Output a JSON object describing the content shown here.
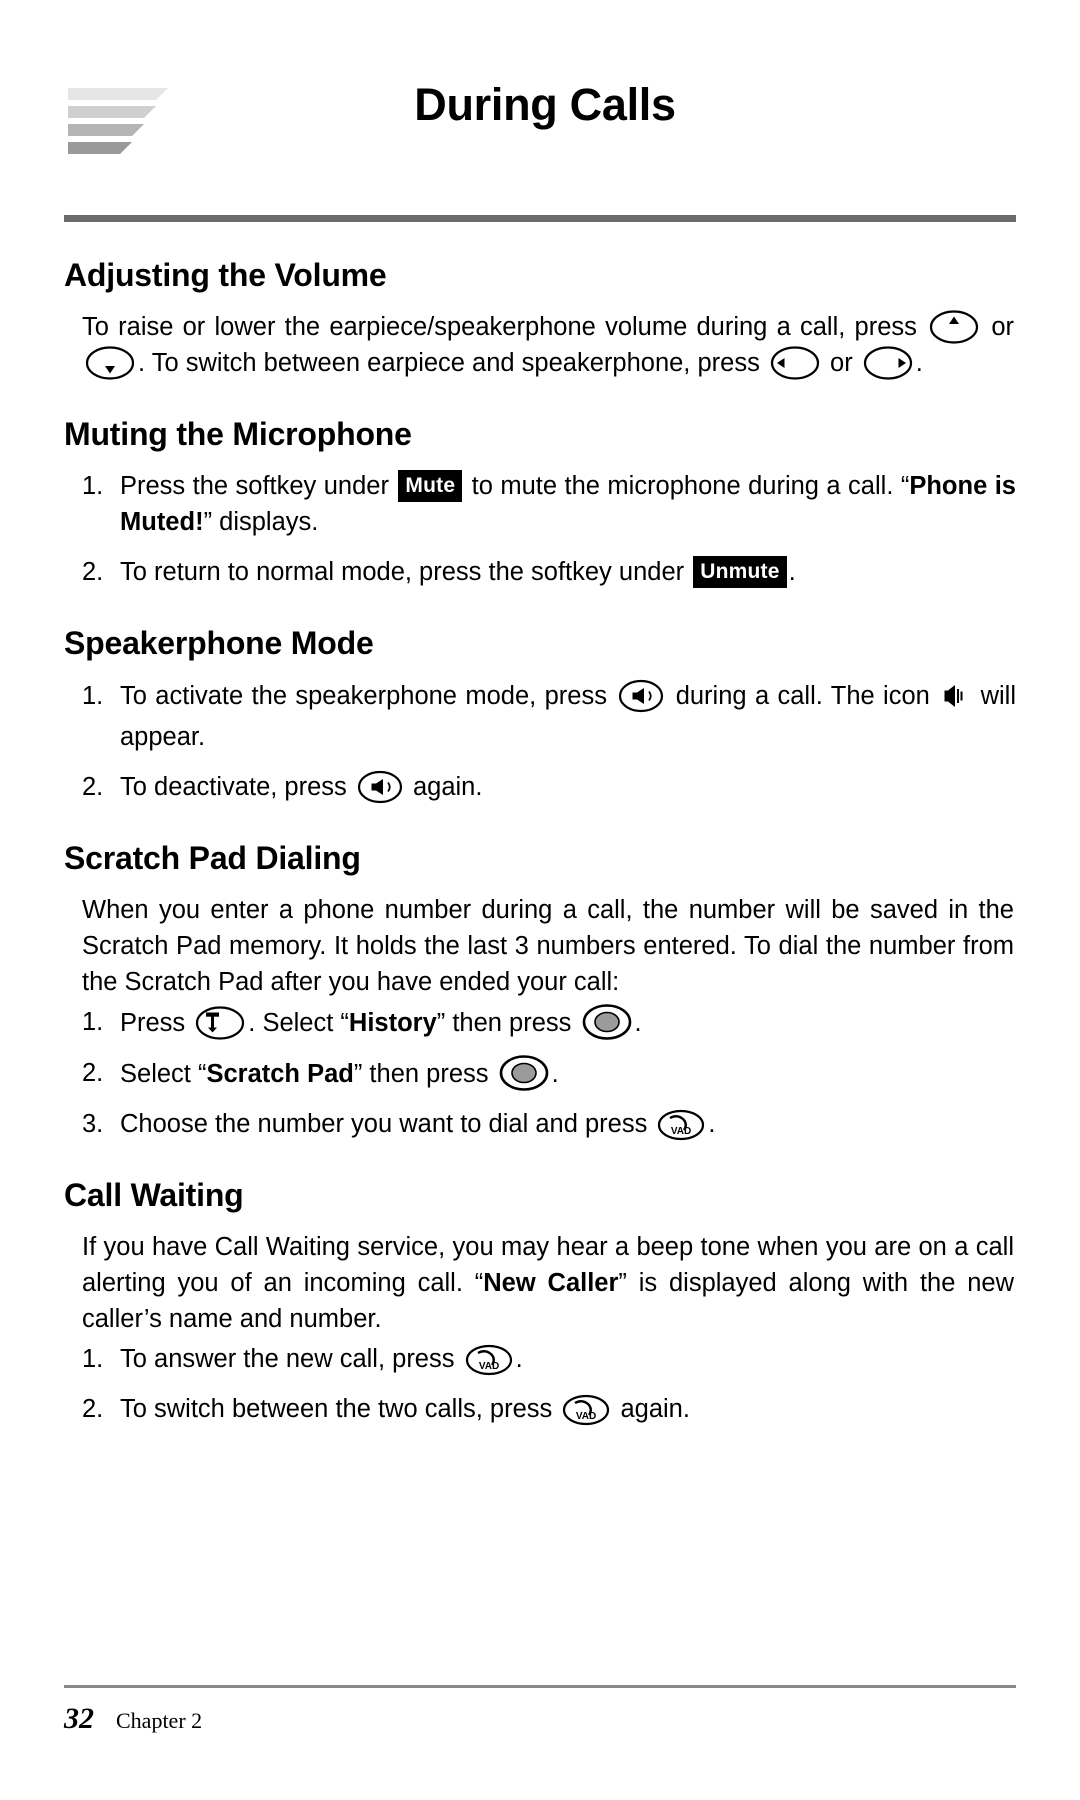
{
  "header": {
    "title": "During Calls",
    "logo_icon": "chevron-stack-logo"
  },
  "sections": [
    {
      "id": "adjusting-the-volume",
      "title": "Adjusting the Volume",
      "paragraph_part1": "To raise or lower the earpiece/speakerphone volume during a call, press ",
      "paragraph_part2": " or ",
      "paragraph_part3": ". To switch between earpiece and speakerphone, press ",
      "paragraph_part4": " or ",
      "paragraph_part5": ".",
      "icons": [
        "nav-up-key-icon",
        "nav-down-key-icon",
        "nav-left-key-icon",
        "nav-right-key-icon"
      ]
    },
    {
      "id": "muting-the-microphone",
      "title": "Muting the Microphone",
      "steps": [
        {
          "num": "1.",
          "part1": "Press the softkey under ",
          "badge": "Mute",
          "part2": " to mute the microphone during a call.  “",
          "bold": "Phone is Muted!",
          "part3": "” displays."
        },
        {
          "num": "2.",
          "part1": "To return to normal mode, press the softkey under ",
          "badge": "Unmute",
          "part2": "."
        }
      ]
    },
    {
      "id": "speakerphone-mode",
      "title": "Speakerphone Mode",
      "steps": [
        {
          "num": "1.",
          "part1": "To activate the speakerphone mode, press ",
          "part2": " during a call. The icon ",
          "part3": " will appear.",
          "icons": [
            "speakerphone-key-icon",
            "speaker-indicator-icon"
          ]
        },
        {
          "num": "2.",
          "part1": "To deactivate, press ",
          "part2": " again.",
          "icons": [
            "speakerphone-key-icon"
          ]
        }
      ]
    },
    {
      "id": "scratch-pad-dialing",
      "title": "Scratch Pad Dialing",
      "paragraph": "When you enter a phone number during a call, the number will be saved in the Scratch Pad memory. It holds the last 3 numbers entered. To dial the number from the Scratch Pad after you have ended your call:",
      "steps": [
        {
          "num": "1.",
          "part1": "Press ",
          "part2": ". Select “",
          "bold": "History",
          "part3": "” then press ",
          "part4": ".",
          "icons": [
            "menu-key-icon",
            "ok-key-icon"
          ]
        },
        {
          "num": "2.",
          "part1": "Select “",
          "bold": "Scratch Pad",
          "part2": "” then press ",
          "part3": ".",
          "icons": [
            "ok-key-icon"
          ]
        },
        {
          "num": "3.",
          "part1": "Choose the number you want to dial and press ",
          "part2": ".",
          "icons": [
            "vad-send-key-icon"
          ]
        }
      ]
    },
    {
      "id": "call-waiting",
      "title": "Call Waiting",
      "paragraph_part1": "If you have Call Waiting service, you may hear a beep tone when you are on a call alerting you of an incoming call. “",
      "paragraph_bold": "New Caller",
      "paragraph_part2": "” is displayed along with the new caller’s name and number.",
      "steps": [
        {
          "num": "1.",
          "part1": "To answer the new call, press ",
          "part2": ".",
          "icons": [
            "vad-send-key-icon"
          ]
        },
        {
          "num": "2.",
          "part1": "To switch between the two calls, press ",
          "part2": " again.",
          "icons": [
            "vad-send-key-icon"
          ]
        }
      ]
    }
  ],
  "footer": {
    "page_number": "32",
    "chapter": "Chapter 2"
  },
  "colors": {
    "text": "#000000",
    "rule": "#6b6b6b",
    "footer_rule": "#8a8a8a",
    "badge_bg": "#000000",
    "badge_fg": "#ffffff"
  }
}
